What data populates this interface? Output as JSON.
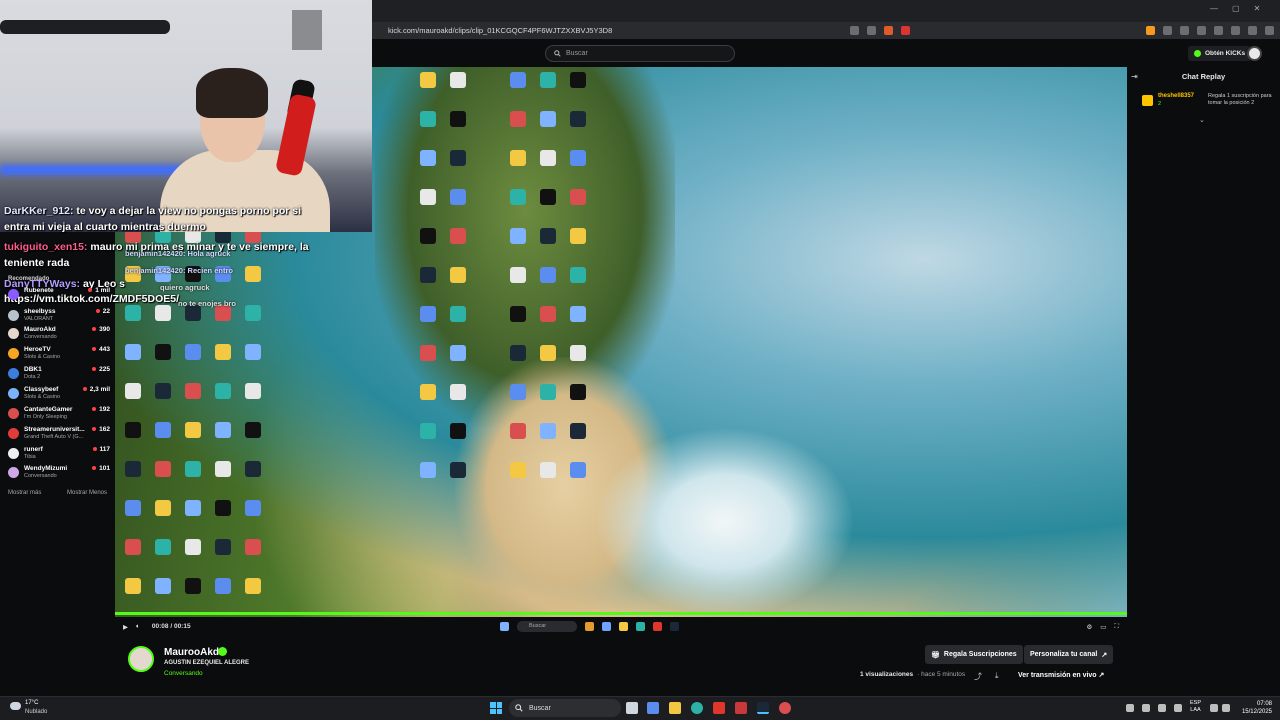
{
  "browser": {
    "url": "kick.com/mauroakd/clips/clip_01KCGQCF4PF6WJTZXXBVJ5Y3D8",
    "window_controls": [
      "—",
      "▢",
      "✕"
    ]
  },
  "header": {
    "search_placeholder": "Buscar",
    "kicks_label": "Obtén KICKs"
  },
  "stream_chat_overlay": [
    {
      "nick": "DarKKer_912:",
      "text": "te voy a dejar la view no pongas porno por si"
    },
    {
      "nick": "",
      "text": "entra mi vieja al cuarto mientras duermo"
    },
    {
      "nick": "tukiguito_xen15:",
      "text": "mauro mi prima es minar y te ve siempre, la"
    },
    {
      "nick": "",
      "text": "teniente rada"
    },
    {
      "nick": "DanyTTYWays:",
      "text": "ay Leo s"
    },
    {
      "nick": "",
      "text": "https://vm.tiktok.com/ZMDF5DOE5/"
    }
  ],
  "overlay_small_chat": [
    {
      "text": "benjamin142420: Hola agruck"
    },
    {
      "text": "benjamin142420: Recien entro"
    },
    {
      "text": "quiero agruck"
    },
    {
      "text": "no te enojes bro"
    }
  ],
  "sidebar": {
    "title": "Recomendado",
    "channels": [
      {
        "name": "Rubenete",
        "category": "",
        "viewers": "1 mil",
        "color": "#8a5cff"
      },
      {
        "name": "sheelbyss",
        "category": "VALORANT",
        "viewers": "22",
        "color": "#b8c2cc"
      },
      {
        "name": "MauroAkd",
        "category": "Conversando",
        "viewers": "390",
        "color": "#e3d8ce"
      },
      {
        "name": "HeroeTV",
        "category": "Slots & Casino",
        "viewers": "443",
        "color": "#f5a623"
      },
      {
        "name": "DBK1",
        "category": "Dota 2",
        "viewers": "225",
        "color": "#3b7ddd"
      },
      {
        "name": "Classybeef",
        "category": "Slots & Casino",
        "viewers": "2,3 mil",
        "color": "#7bb3ff"
      },
      {
        "name": "CantanteGamer",
        "category": "I'm Only Sleeping",
        "viewers": "192",
        "color": "#d94f4f"
      },
      {
        "name": "Streameruniversit...",
        "category": "Grand Theft Auto V (G...",
        "viewers": "162",
        "color": "#e23b3b"
      },
      {
        "name": "runerf",
        "category": "Tibia",
        "viewers": "117",
        "color": "#f0f0f0"
      },
      {
        "name": "WendyMizumi",
        "category": "Conversando",
        "viewers": "101",
        "color": "#cfa7e8"
      }
    ],
    "show_more": "Mostrar más",
    "show_less": "Mostrar Menos"
  },
  "player": {
    "time": "00:08 / 00:15",
    "progress": 1.0,
    "taskbar_search": "Buscar"
  },
  "chat_replay": {
    "title": "Chat Replay",
    "event": {
      "user": "theshell8357",
      "sub_count": "2",
      "message": "Regala 1 suscripción para tomar la posición 2"
    }
  },
  "channel": {
    "name": "MaurooAkd",
    "title": "AGUSTIN EZEQUIEL ALEGRE",
    "category": "Conversando",
    "gift_subs_label": "Regala Suscripciones",
    "customize_label": "Personaliza tu canal",
    "views": "1 visualizaciones",
    "ago": "· hace 5 minutos",
    "watch_live_label": "Ver transmisión en vivo"
  },
  "taskbar": {
    "weather_temp": "17°C",
    "weather_desc": "Nublado",
    "search_label": "Buscar",
    "lang_top": "ESP",
    "lang_bottom": "LAA",
    "time": "07:08",
    "date": "15/12/2025"
  },
  "colors": {
    "kick_green": "#53fc18",
    "background": "#0b0c0e"
  }
}
